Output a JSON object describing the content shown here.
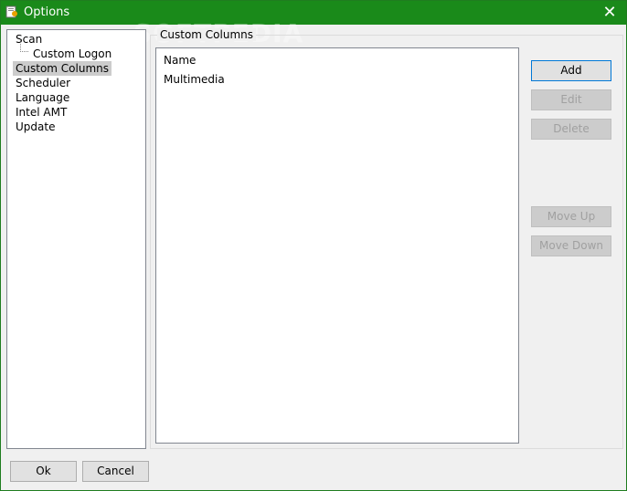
{
  "window": {
    "title": "Options",
    "watermark": "SOFTPEDIA"
  },
  "tree": {
    "items": [
      {
        "label": "Scan"
      },
      {
        "label": "Custom Logon"
      },
      {
        "label": "Custom Columns"
      },
      {
        "label": "Scheduler"
      },
      {
        "label": "Language"
      },
      {
        "label": "Intel AMT"
      },
      {
        "label": "Update"
      }
    ]
  },
  "panel": {
    "group_label": "Custom Columns",
    "columns": [
      {
        "label": "Name"
      },
      {
        "label": "Multimedia"
      }
    ]
  },
  "buttons": {
    "add": "Add",
    "edit": "Edit",
    "delete": "Delete",
    "move_up": "Move Up",
    "move_down": "Move Down",
    "ok": "Ok",
    "cancel": "Cancel"
  },
  "colors": {
    "titlebar": "#1a8a1a",
    "selection": "#cccccc",
    "default_button_border": "#0078d7"
  }
}
